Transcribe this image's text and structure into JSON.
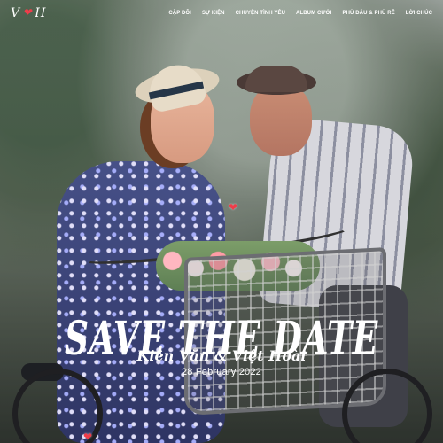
{
  "header": {
    "logo_left": "V",
    "logo_right": "H",
    "logo_heart_icon": "heart-icon",
    "nav": [
      {
        "label": "CẶP ĐÔI"
      },
      {
        "label": "SỰ KIỆN"
      },
      {
        "label": "CHUYỆN TÌNH YÊU"
      },
      {
        "label": "ALBUM CƯỚI"
      },
      {
        "label": "PHÙ DÂU & PHÙ RỂ"
      },
      {
        "label": "LỜI CHÚC"
      }
    ]
  },
  "hero": {
    "title": "Save the date",
    "names": "Kiên Văn & Việt Hoài",
    "date": "28 February 2022"
  },
  "decor": {
    "heart_icon_1": "heart-icon",
    "heart_icon_2": "heart-icon"
  }
}
